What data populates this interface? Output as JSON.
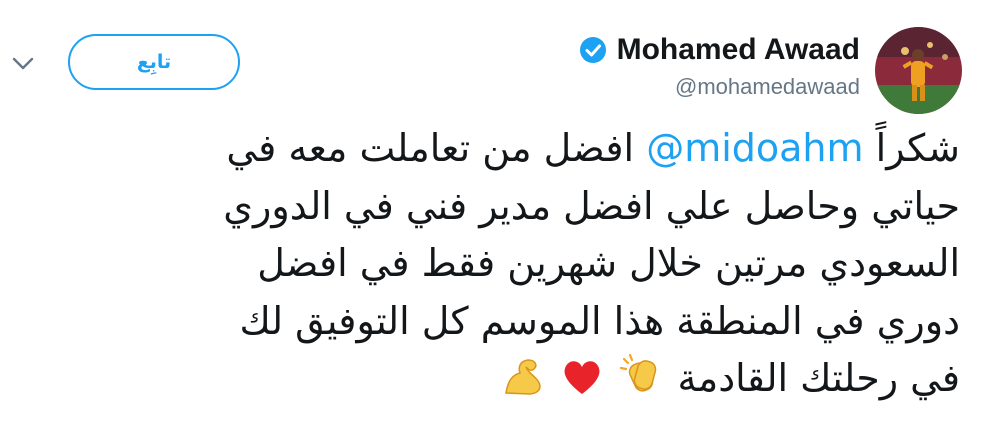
{
  "profile": {
    "display_name": "Mohamed Awaad",
    "handle": "@mohamedawaad",
    "verified": true,
    "avatar": "avatar-photo"
  },
  "actions": {
    "follow_label": "تابِع",
    "menu_icon": "chevron-down-icon"
  },
  "tweet": {
    "line1_before": "شكراً",
    "mention": "@midoahm",
    "line1_after": "افضل من تعاملت معه في",
    "line2": "حياتي وحاصل علي افضل مدير فني في الدوري",
    "line3": "السعودي مرتين خلال شهرين فقط في افضل",
    "line4": "دوري في المنطقة  هذا الموسم كل التوفيق لك",
    "line5": "في رحلتك القادمة",
    "emojis": [
      "clapping-hands-icon",
      "red-heart-icon",
      "flexed-biceps-icon"
    ]
  },
  "colors": {
    "accent": "#1da1f2",
    "text": "#14171a",
    "secondary": "#657786"
  }
}
